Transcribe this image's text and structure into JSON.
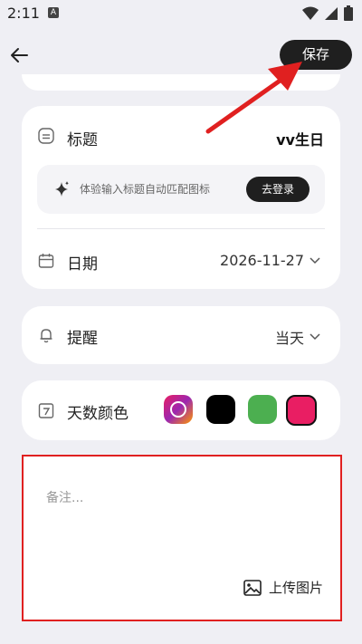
{
  "status_bar": {
    "time": "2:11",
    "badge": "A"
  },
  "header": {
    "save_label": "保存"
  },
  "title_row": {
    "label": "标题",
    "value": "vv生日"
  },
  "hint": {
    "text": "体验输入标题自动匹配图标",
    "login_label": "去登录"
  },
  "date_row": {
    "label": "日期",
    "value": "2026-11-27"
  },
  "reminder_row": {
    "label": "提醒",
    "value": "当天"
  },
  "color_row": {
    "label": "天数颜色",
    "swatches": [
      "gradient",
      "#000000",
      "#4caf50",
      "#e91e63"
    ],
    "selected_index": 3
  },
  "notes": {
    "placeholder": "备注...",
    "upload_label": "上传图片"
  },
  "annotation_colors": {
    "highlight": "#e02020",
    "arrow": "#e02020"
  }
}
